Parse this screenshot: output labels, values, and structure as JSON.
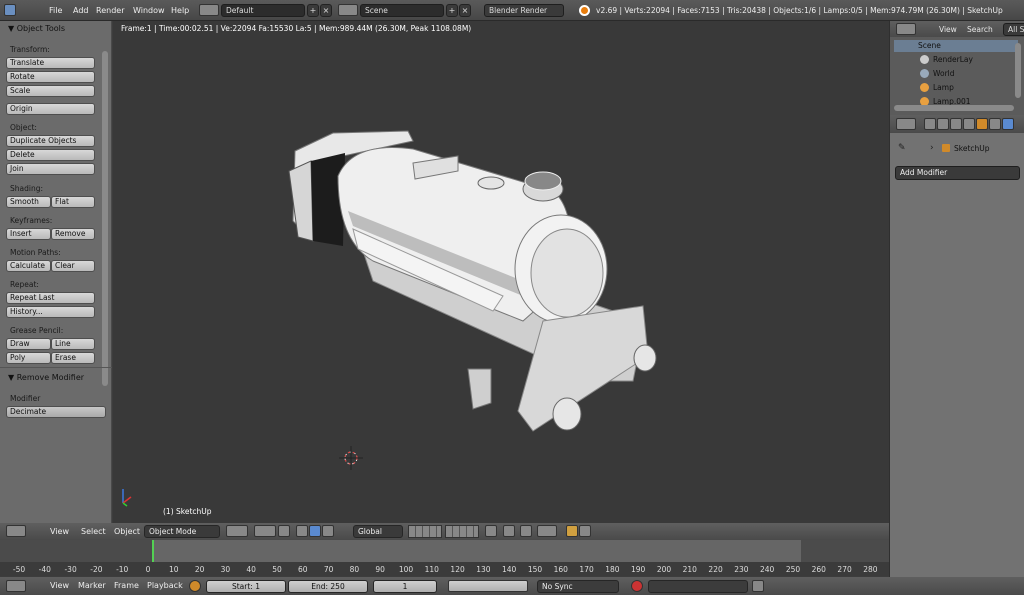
{
  "topbar": {
    "menus": [
      "File",
      "Add",
      "Render",
      "Window",
      "Help"
    ],
    "screen_layout": "Default",
    "scene": "Scene",
    "render_engine": "Blender Render",
    "stats": "v2.69 | Verts:22094 | Faces:7153 | Tris:20438 | Objects:1/6 | Lamps:0/5 | Mem:974.79M (26.30M) | SketchUp"
  },
  "toolpanel": {
    "title": "Object Tools",
    "transform_label": "Transform:",
    "translate": "Translate",
    "rotate": "Rotate",
    "scale": "Scale",
    "origin": "Origin",
    "object_label": "Object:",
    "duplicate": "Duplicate Objects",
    "delete": "Delete",
    "join": "Join",
    "shading_label": "Shading:",
    "smooth": "Smooth",
    "flat": "Flat",
    "keyframes_label": "Keyframes:",
    "insert": "Insert",
    "remove": "Remove",
    "motion_label": "Motion Paths:",
    "calculate": "Calculate",
    "clear": "Clear",
    "repeat_label": "Repeat:",
    "repeat_last": "Repeat Last",
    "history": "History...",
    "grease_label": "Grease Pencil:",
    "draw": "Draw",
    "line": "Line",
    "poly": "Poly",
    "erase": "Erase",
    "operator_title": "Remove Modifier",
    "modifier_label": "Modifier",
    "modifier_value": "Decimate"
  },
  "viewport": {
    "info": "Frame:1 | Time:00:02.51 | Ve:22094 Fa:15530 La:5 | Mem:989.44M (26.30M, Peak 1108.08M)",
    "object_name": "(1) SketchUp"
  },
  "outliner": {
    "view": "View",
    "search": "Search",
    "all_scenes": "All S",
    "items": [
      "Scene",
      "RenderLay",
      "World",
      "Lamp",
      "Lamp.001"
    ]
  },
  "properties": {
    "object": "SketchUp",
    "add_modifier": "Add Modifier"
  },
  "view3d_header": {
    "view": "View",
    "select": "Select",
    "object": "Object",
    "mode": "Object Mode",
    "orientation": "Global"
  },
  "timeline": {
    "ticks": [
      "-50",
      "-40",
      "-30",
      "-20",
      "-10",
      "0",
      "10",
      "20",
      "30",
      "40",
      "50",
      "60",
      "70",
      "80",
      "90",
      "100",
      "110",
      "120",
      "130",
      "140",
      "150",
      "160",
      "170",
      "180",
      "190",
      "200",
      "210",
      "220",
      "230",
      "240",
      "250",
      "260",
      "270",
      "280"
    ],
    "current_frame_tick": "0"
  },
  "timeline_header": {
    "view": "View",
    "marker": "Marker",
    "frame": "Frame",
    "playback": "Playback",
    "start": "Start: 1",
    "end": "End: 250",
    "current": "1",
    "sync": "No Sync"
  }
}
